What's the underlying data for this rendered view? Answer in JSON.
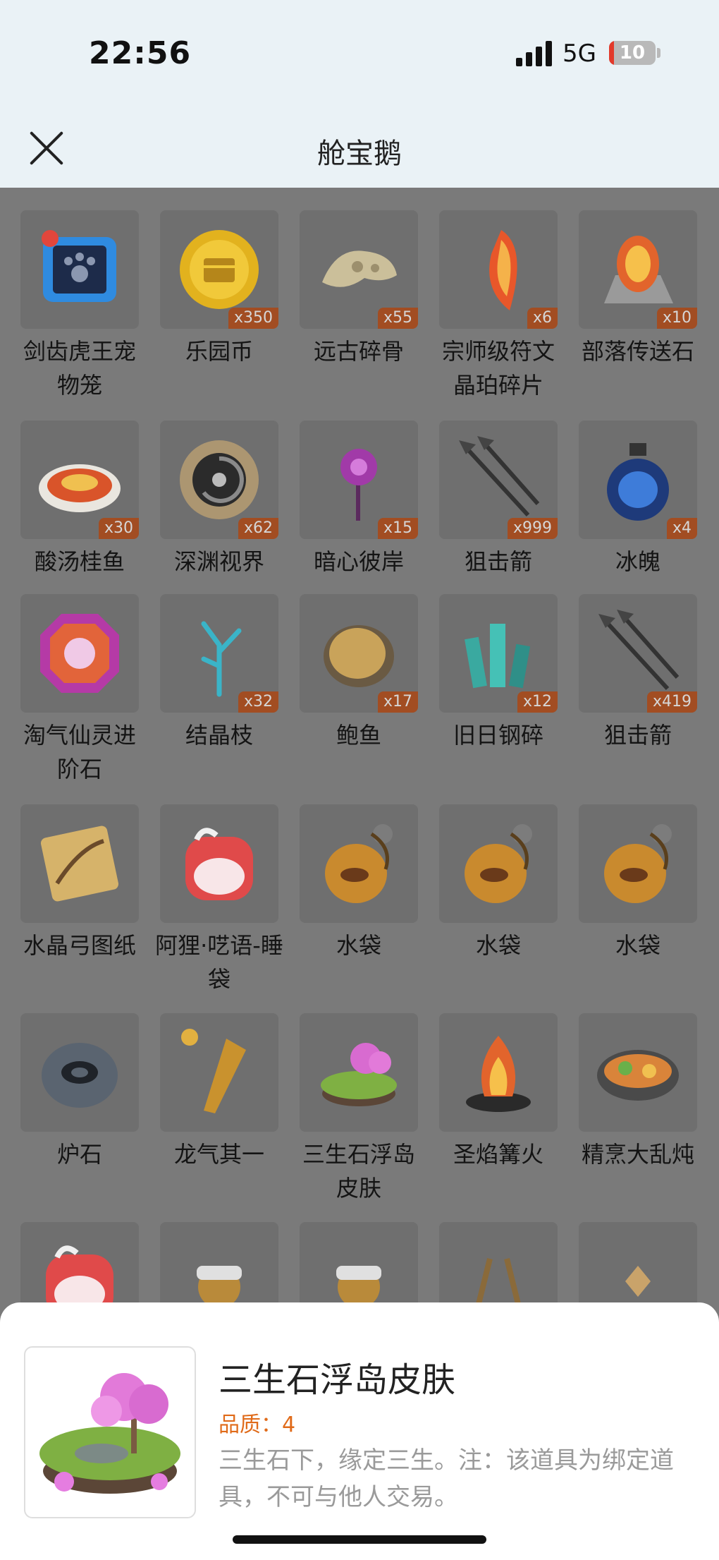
{
  "status": {
    "time": "22:56",
    "network": "5G",
    "battery": "10",
    "battery_level": 0.1
  },
  "header": {
    "title": "舱宝鹅"
  },
  "items": [
    {
      "name": "剑齿虎王宠物笼",
      "count": "",
      "icon": "pet-cage-icon"
    },
    {
      "name": "乐园币",
      "count": "x350",
      "icon": "gold-coin-icon"
    },
    {
      "name": "远古碎骨",
      "count": "x55",
      "icon": "bone-fragment-icon"
    },
    {
      "name": "宗师级符文晶珀碎片",
      "count": "x6",
      "icon": "amber-shard-icon"
    },
    {
      "name": "部落传送石",
      "count": "x10",
      "icon": "teleport-stone-icon"
    },
    {
      "name": "酸汤桂鱼",
      "count": "x30",
      "icon": "fish-dish-icon"
    },
    {
      "name": "深渊视界",
      "count": "x62",
      "icon": "abyss-eye-icon"
    },
    {
      "name": "暗心彼岸",
      "count": "x15",
      "icon": "spider-lily-icon"
    },
    {
      "name": "狙击箭",
      "count": "x999",
      "icon": "arrow-icon"
    },
    {
      "name": "冰魄",
      "count": "x4",
      "icon": "potion-bottle-icon"
    },
    {
      "name": "淘气仙灵进阶石",
      "count": "",
      "icon": "fairy-gem-icon"
    },
    {
      "name": "结晶枝",
      "count": "x32",
      "icon": "crystal-branch-icon"
    },
    {
      "name": "鲍鱼",
      "count": "x17",
      "icon": "abalone-icon"
    },
    {
      "name": "旧日钢碎",
      "count": "x12",
      "icon": "steel-crystal-icon"
    },
    {
      "name": "狙击箭",
      "count": "x419",
      "icon": "arrow-icon"
    },
    {
      "name": "水晶弓图纸",
      "count": "",
      "icon": "bow-scroll-icon"
    },
    {
      "name": "阿狸·呓语-睡袋",
      "count": "",
      "icon": "sleeping-bag-icon"
    },
    {
      "name": "水袋",
      "count": "",
      "icon": "water-bag-icon"
    },
    {
      "name": "水袋",
      "count": "",
      "icon": "water-bag-icon"
    },
    {
      "name": "水袋",
      "count": "",
      "icon": "water-bag-icon"
    },
    {
      "name": "炉石",
      "count": "",
      "icon": "hearthstone-icon"
    },
    {
      "name": "龙气其一",
      "count": "",
      "icon": "dragon-relic-icon"
    },
    {
      "name": "三生石浮岛皮肤",
      "count": "",
      "icon": "floating-island-icon"
    },
    {
      "name": "圣焰篝火",
      "count": "",
      "icon": "campfire-icon"
    },
    {
      "name": "精烹大乱炖",
      "count": "",
      "icon": "stew-bowl-icon"
    },
    {
      "name": "",
      "count": "",
      "icon": "sleeping-bag-icon"
    },
    {
      "name": "",
      "count": "",
      "icon": "golden-cannon-icon"
    },
    {
      "name": "",
      "count": "",
      "icon": "golden-cannon-icon"
    },
    {
      "name": "",
      "count": "",
      "icon": "wooden-frame-icon"
    },
    {
      "name": "",
      "count": "",
      "icon": "small-gem-icon"
    }
  ],
  "detail": {
    "name": "三生石浮岛皮肤",
    "quality": "品质：4",
    "description": "三生石下，缘定三生。注：该道具为绑定道具，不可与他人交易。",
    "icon": "floating-island-icon"
  }
}
